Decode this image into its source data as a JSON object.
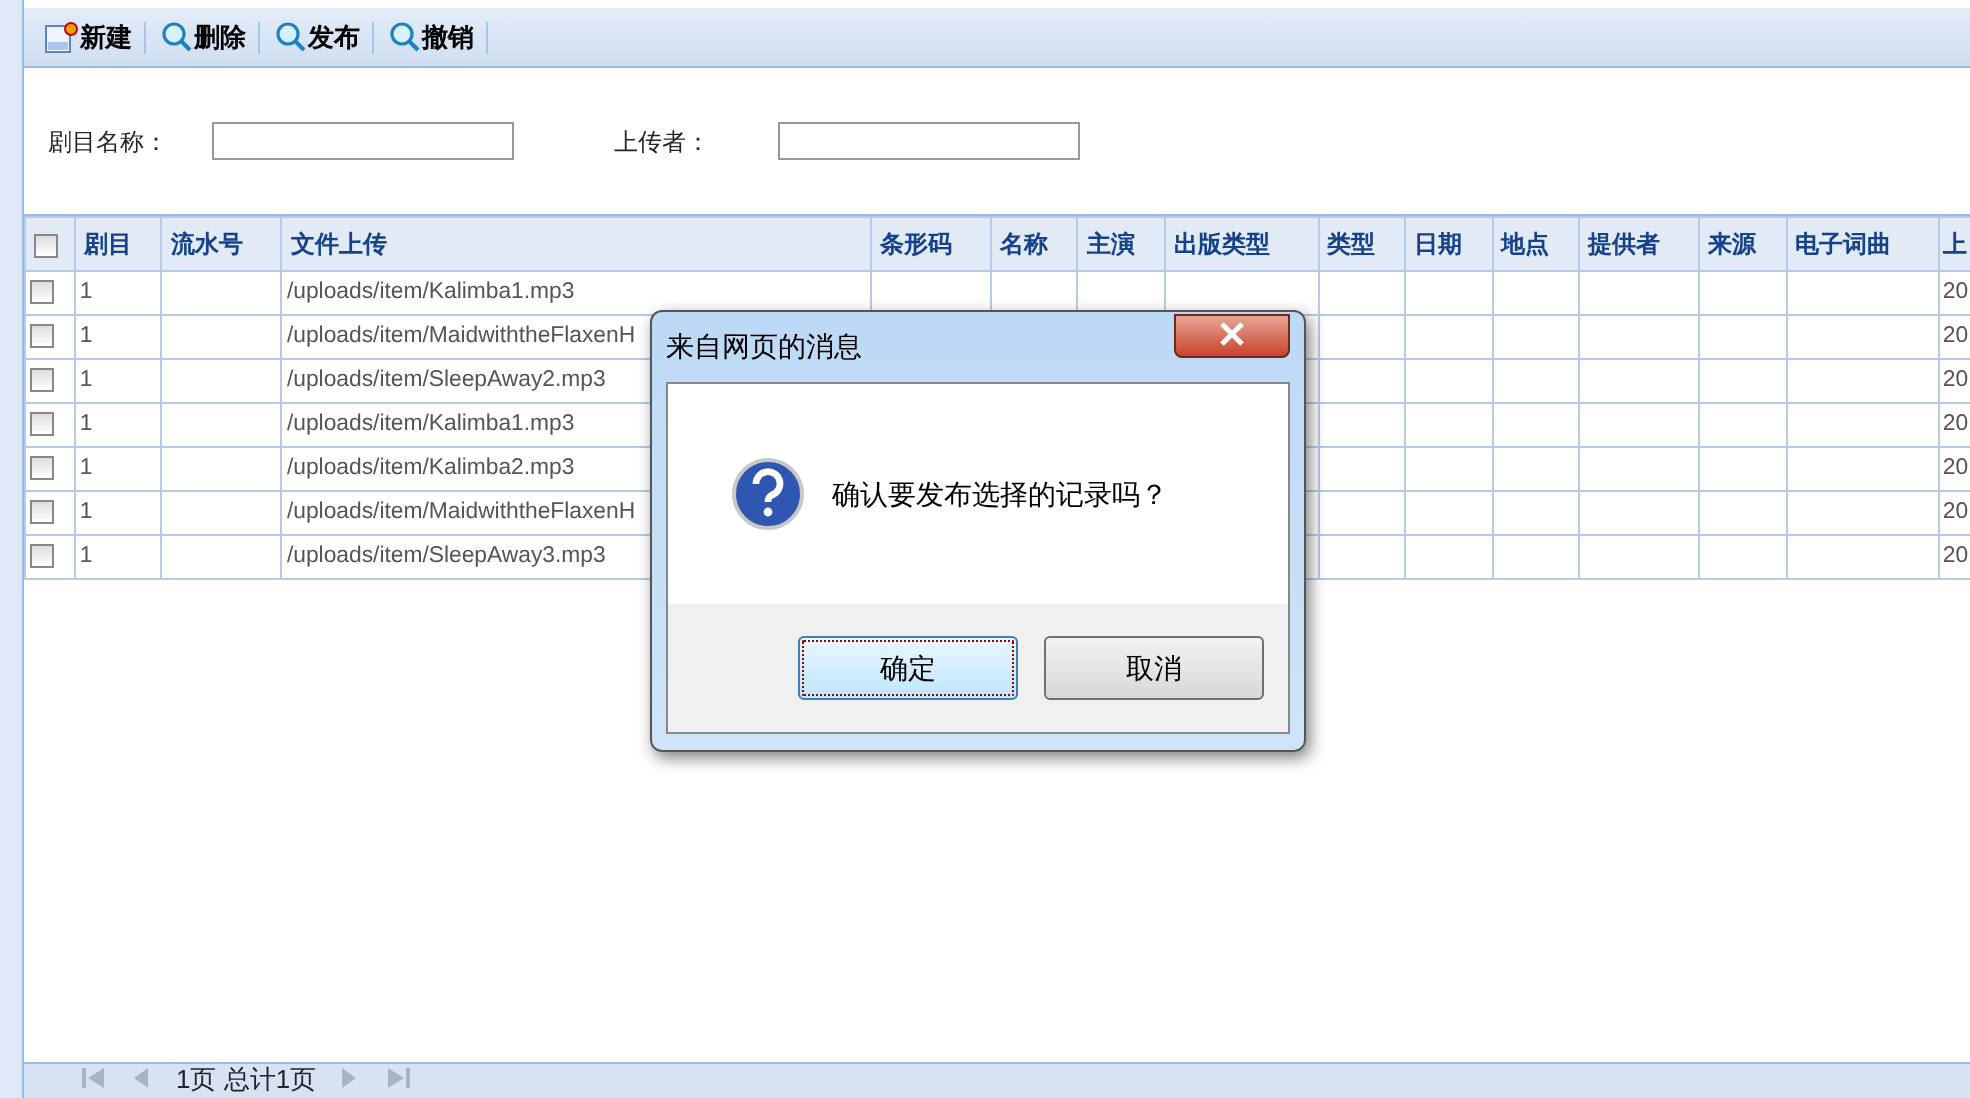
{
  "toolbar": [
    {
      "label": "新建",
      "kind": "new"
    },
    {
      "label": "删除",
      "kind": "search"
    },
    {
      "label": "发布",
      "kind": "search"
    },
    {
      "label": "撤销",
      "kind": "search"
    }
  ],
  "filters": [
    {
      "label": "剧目名称："
    },
    {
      "label": "上传者："
    }
  ],
  "table": {
    "select_all": {
      "checked": false
    },
    "columns": [
      "剧目",
      "流水号",
      "文件上传",
      "条形码",
      "名称",
      "主演",
      "出版类型",
      "类型",
      "日期",
      "地点",
      "提供者",
      "来源",
      "电子词曲",
      "上"
    ],
    "rows": [
      {
        "checked": false,
        "cells": [
          "1",
          "",
          "/uploads/item/Kalimba1.mp3",
          "",
          "",
          "",
          "",
          "",
          "",
          "",
          "",
          "",
          "",
          "20"
        ]
      },
      {
        "checked": false,
        "cells": [
          "1",
          "",
          "/uploads/item/MaidwiththeFlaxenH",
          "",
          "",
          "",
          "",
          "",
          "",
          "",
          "",
          "",
          "",
          "20"
        ]
      },
      {
        "checked": false,
        "cells": [
          "1",
          "",
          "/uploads/item/SleepAway2.mp3",
          "",
          "",
          "",
          "",
          "",
          "",
          "",
          "",
          "",
          "",
          "20"
        ]
      },
      {
        "checked": false,
        "cells": [
          "1",
          "",
          "/uploads/item/Kalimba1.mp3",
          "",
          "",
          "",
          "",
          "",
          "",
          "",
          "",
          "",
          "",
          "20"
        ]
      },
      {
        "checked": false,
        "cells": [
          "1",
          "",
          "/uploads/item/Kalimba2.mp3",
          "",
          "",
          "",
          "",
          "",
          "",
          "",
          "",
          "",
          "",
          "20"
        ]
      },
      {
        "checked": false,
        "cells": [
          "1",
          "",
          "/uploads/item/MaidwiththeFlaxenH",
          "",
          "",
          "",
          "",
          "",
          "",
          "",
          "",
          "",
          "",
          "20"
        ]
      },
      {
        "checked": false,
        "cells": [
          "1",
          "",
          "/uploads/item/SleepAway3.mp3",
          "",
          "",
          "",
          "",
          "",
          "",
          "",
          "",
          "",
          "",
          "20"
        ]
      }
    ]
  },
  "pager": {
    "text": "1页 总计1页",
    "first_disabled": true,
    "prev_disabled": true,
    "next_disabled": true,
    "last_disabled": true
  },
  "dialog": {
    "title": "来自网页的消息",
    "message": "确认要发布选择的记录吗？",
    "buttons": [
      {
        "label": "确定",
        "default": true
      },
      {
        "label": "取消",
        "default": false
      }
    ]
  }
}
